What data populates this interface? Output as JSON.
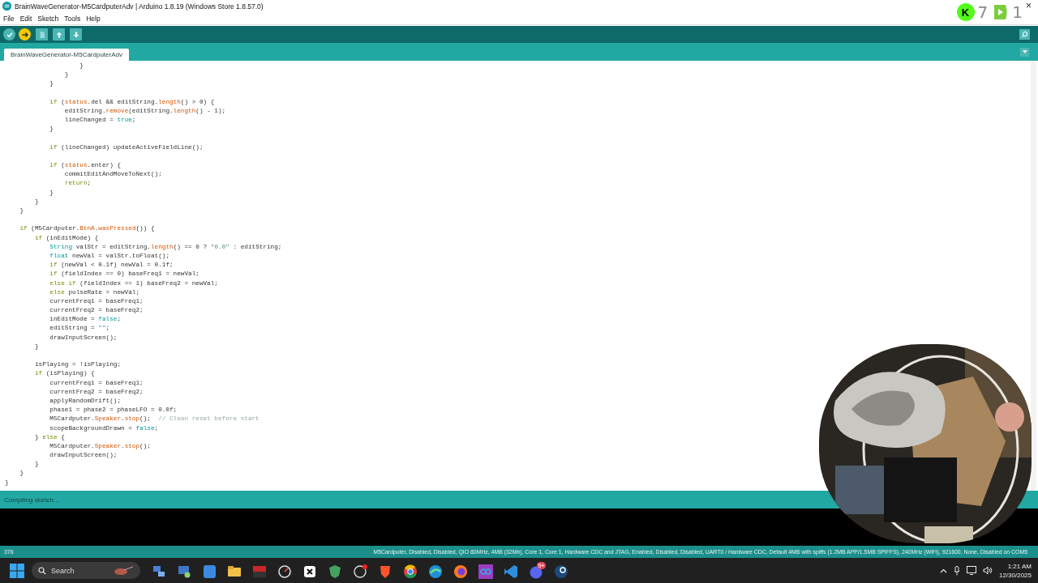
{
  "window": {
    "title": "BrainWaveGenerator-M5CardputerAdv | Arduino 1.8.19 (Windows Store 1.8.57.0)",
    "close": "×"
  },
  "overlay": {
    "logo_letter": "K",
    "count_1": "7",
    "count_2": "1"
  },
  "menu": [
    "File",
    "Edit",
    "Sketch",
    "Tools",
    "Help"
  ],
  "toolbar": [
    {
      "kind": "verify",
      "active": false
    },
    {
      "kind": "upload",
      "active": true
    },
    {
      "kind": "new",
      "active": false
    },
    {
      "kind": "open",
      "active": false
    },
    {
      "kind": "save",
      "active": false
    }
  ],
  "tabs": [
    {
      "label": "BrainWaveGenerator-M5CardputerAdv",
      "selected": true
    }
  ],
  "code_lines": [
    {
      "kind": "code",
      "segments": [
        {
          "text": "                    }",
          "kind": "p"
        }
      ]
    },
    {
      "kind": "code",
      "segments": [
        {
          "text": "                }",
          "kind": "p"
        }
      ]
    },
    {
      "kind": "code",
      "segments": [
        {
          "text": "            }",
          "kind": "p"
        }
      ]
    },
    {
      "kind": "blank"
    },
    {
      "kind": "code",
      "segments": [
        {
          "text": "            if",
          "kind": "k"
        },
        {
          "text": " (",
          "kind": "p"
        },
        {
          "text": "status",
          "kind": "f"
        },
        {
          "text": ".del && editString.",
          "kind": "p"
        },
        {
          "text": "length",
          "kind": "f"
        },
        {
          "text": "() > 0) {",
          "kind": "p"
        }
      ]
    },
    {
      "kind": "code",
      "segments": [
        {
          "text": "                editString.",
          "kind": "p"
        },
        {
          "text": "remove",
          "kind": "f"
        },
        {
          "text": "(editString.",
          "kind": "p"
        },
        {
          "text": "length",
          "kind": "f"
        },
        {
          "text": "() - 1);",
          "kind": "p"
        }
      ]
    },
    {
      "kind": "code",
      "segments": [
        {
          "text": "                lineChanged = ",
          "kind": "p"
        },
        {
          "text": "true",
          "kind": "t"
        },
        {
          "text": ";",
          "kind": "p"
        }
      ]
    },
    {
      "kind": "code",
      "segments": [
        {
          "text": "            }",
          "kind": "p"
        }
      ]
    },
    {
      "kind": "blank"
    },
    {
      "kind": "code",
      "segments": [
        {
          "text": "            if",
          "kind": "k"
        },
        {
          "text": " (lineChanged) updateActiveFieldLine();",
          "kind": "p"
        }
      ]
    },
    {
      "kind": "blank"
    },
    {
      "kind": "code",
      "segments": [
        {
          "text": "            if",
          "kind": "k"
        },
        {
          "text": " (",
          "kind": "p"
        },
        {
          "text": "status",
          "kind": "f"
        },
        {
          "text": ".enter) {",
          "kind": "p"
        }
      ]
    },
    {
      "kind": "code",
      "segments": [
        {
          "text": "                commitEditAndMoveToNext();",
          "kind": "p"
        }
      ]
    },
    {
      "kind": "code",
      "segments": [
        {
          "text": "                return",
          "kind": "k"
        },
        {
          "text": ";",
          "kind": "p"
        }
      ]
    },
    {
      "kind": "code",
      "segments": [
        {
          "text": "            }",
          "kind": "p"
        }
      ]
    },
    {
      "kind": "code",
      "segments": [
        {
          "text": "        }",
          "kind": "p"
        }
      ]
    },
    {
      "kind": "code",
      "segments": [
        {
          "text": "    }",
          "kind": "p"
        }
      ]
    },
    {
      "kind": "blank"
    },
    {
      "kind": "code",
      "segments": [
        {
          "text": "    if",
          "kind": "k"
        },
        {
          "text": " (M5Cardputer.",
          "kind": "p"
        },
        {
          "text": "BtnA",
          "kind": "f"
        },
        {
          "text": ".",
          "kind": "p"
        },
        {
          "text": "wasPressed",
          "kind": "f"
        },
        {
          "text": "()) {",
          "kind": "p"
        }
      ]
    },
    {
      "kind": "code",
      "segments": [
        {
          "text": "        if",
          "kind": "k"
        },
        {
          "text": " (inEditMode) {",
          "kind": "p"
        }
      ]
    },
    {
      "kind": "code",
      "segments": [
        {
          "text": "            String",
          "kind": "t"
        },
        {
          "text": " valStr = editString.",
          "kind": "p"
        },
        {
          "text": "length",
          "kind": "f"
        },
        {
          "text": "() == 0 ? ",
          "kind": "p"
        },
        {
          "text": "\"0.0\"",
          "kind": "s"
        },
        {
          "text": " : editString;",
          "kind": "p"
        }
      ]
    },
    {
      "kind": "code",
      "segments": [
        {
          "text": "            float",
          "kind": "t"
        },
        {
          "text": " newVal = valStr.toFloat();",
          "kind": "p"
        }
      ]
    },
    {
      "kind": "code",
      "segments": [
        {
          "text": "            if",
          "kind": "k"
        },
        {
          "text": " (newVal < 0.1f) newVal = 0.1f;",
          "kind": "p"
        }
      ]
    },
    {
      "kind": "code",
      "segments": [
        {
          "text": "            if",
          "kind": "k"
        },
        {
          "text": " (fieldIndex == 0) baseFreq1 = newVal;",
          "kind": "p"
        }
      ]
    },
    {
      "kind": "code",
      "segments": [
        {
          "text": "            else if",
          "kind": "k"
        },
        {
          "text": " (fieldIndex == 1) baseFreq2 = newVal;",
          "kind": "p"
        }
      ]
    },
    {
      "kind": "code",
      "segments": [
        {
          "text": "            else",
          "kind": "k"
        },
        {
          "text": " pulseRate = newVal;",
          "kind": "p"
        }
      ]
    },
    {
      "kind": "code",
      "segments": [
        {
          "text": "            currentFreq1 = baseFreq1;",
          "kind": "p"
        }
      ]
    },
    {
      "kind": "code",
      "segments": [
        {
          "text": "            currentFreq2 = baseFreq2;",
          "kind": "p"
        }
      ]
    },
    {
      "kind": "code",
      "segments": [
        {
          "text": "            inEditMode = ",
          "kind": "p"
        },
        {
          "text": "false",
          "kind": "t"
        },
        {
          "text": ";",
          "kind": "p"
        }
      ]
    },
    {
      "kind": "code",
      "segments": [
        {
          "text": "            editString = ",
          "kind": "p"
        },
        {
          "text": "\"\"",
          "kind": "s"
        },
        {
          "text": ";",
          "kind": "p"
        }
      ]
    },
    {
      "kind": "code",
      "segments": [
        {
          "text": "            drawInputScreen();",
          "kind": "p"
        }
      ]
    },
    {
      "kind": "code",
      "segments": [
        {
          "text": "        }",
          "kind": "p"
        }
      ]
    },
    {
      "kind": "blank"
    },
    {
      "kind": "code",
      "segments": [
        {
          "text": "        isPlaying = !isPlaying;",
          "kind": "p"
        }
      ]
    },
    {
      "kind": "code",
      "segments": [
        {
          "text": "        if",
          "kind": "k"
        },
        {
          "text": " (isPlaying) {",
          "kind": "p"
        }
      ]
    },
    {
      "kind": "code",
      "segments": [
        {
          "text": "            currentFreq1 = baseFreq1;",
          "kind": "p"
        }
      ]
    },
    {
      "kind": "code",
      "segments": [
        {
          "text": "            currentFreq2 = baseFreq2;",
          "kind": "p"
        }
      ]
    },
    {
      "kind": "code",
      "segments": [
        {
          "text": "            applyRandomDrift();",
          "kind": "p"
        }
      ]
    },
    {
      "kind": "code",
      "segments": [
        {
          "text": "            phase1 = phase2 = phaseLFO = 0.0f;",
          "kind": "p"
        }
      ]
    },
    {
      "kind": "code",
      "segments": [
        {
          "text": "            M5Cardputer.",
          "kind": "p"
        },
        {
          "text": "Speaker",
          "kind": "f"
        },
        {
          "text": ".",
          "kind": "p"
        },
        {
          "text": "stop",
          "kind": "f"
        },
        {
          "text": "();  ",
          "kind": "p"
        },
        {
          "text": "// Clean reset before start",
          "kind": "c"
        }
      ]
    },
    {
      "kind": "code",
      "segments": [
        {
          "text": "            scopeBackgroundDrawn = ",
          "kind": "p"
        },
        {
          "text": "false",
          "kind": "t"
        },
        {
          "text": ";",
          "kind": "p"
        }
      ]
    },
    {
      "kind": "code",
      "segments": [
        {
          "text": "        } ",
          "kind": "p"
        },
        {
          "text": "else",
          "kind": "k"
        },
        {
          "text": " {",
          "kind": "p"
        }
      ]
    },
    {
      "kind": "code",
      "segments": [
        {
          "text": "            M5Cardputer.",
          "kind": "p"
        },
        {
          "text": "Speaker",
          "kind": "f"
        },
        {
          "text": ".",
          "kind": "p"
        },
        {
          "text": "stop",
          "kind": "f"
        },
        {
          "text": "();",
          "kind": "p"
        }
      ]
    },
    {
      "kind": "code",
      "segments": [
        {
          "text": "            drawInputScreen();",
          "kind": "p"
        }
      ]
    },
    {
      "kind": "code",
      "segments": [
        {
          "text": "        }",
          "kind": "p"
        }
      ]
    },
    {
      "kind": "code",
      "segments": [
        {
          "text": "    }",
          "kind": "p"
        }
      ]
    },
    {
      "kind": "code",
      "segments": [
        {
          "text": "}",
          "kind": "p"
        }
      ]
    }
  ],
  "status_message": "Compiling sketch...",
  "status_bar": {
    "line": "376",
    "board": "M5Cardputer, Disabled, Disabled, QIO 80MHz, 4MB (32Mb), Core 1, Core 1, Hardware CDC and JTAG, Enabled, Disabled, Disabled, UART0 / Hardware CDC, Default 4MB with spiffs (1.2MB APP/1.5MB SPIFFS), 240MHz (WiFi), 921600, None, Disabled on COM5"
  },
  "webcam": {
    "kind": "picture"
  },
  "taskbar": {
    "search_placeholder": "Search",
    "discord_badge": "9+",
    "time": "1:21 AM",
    "date": "12/30/2025"
  }
}
